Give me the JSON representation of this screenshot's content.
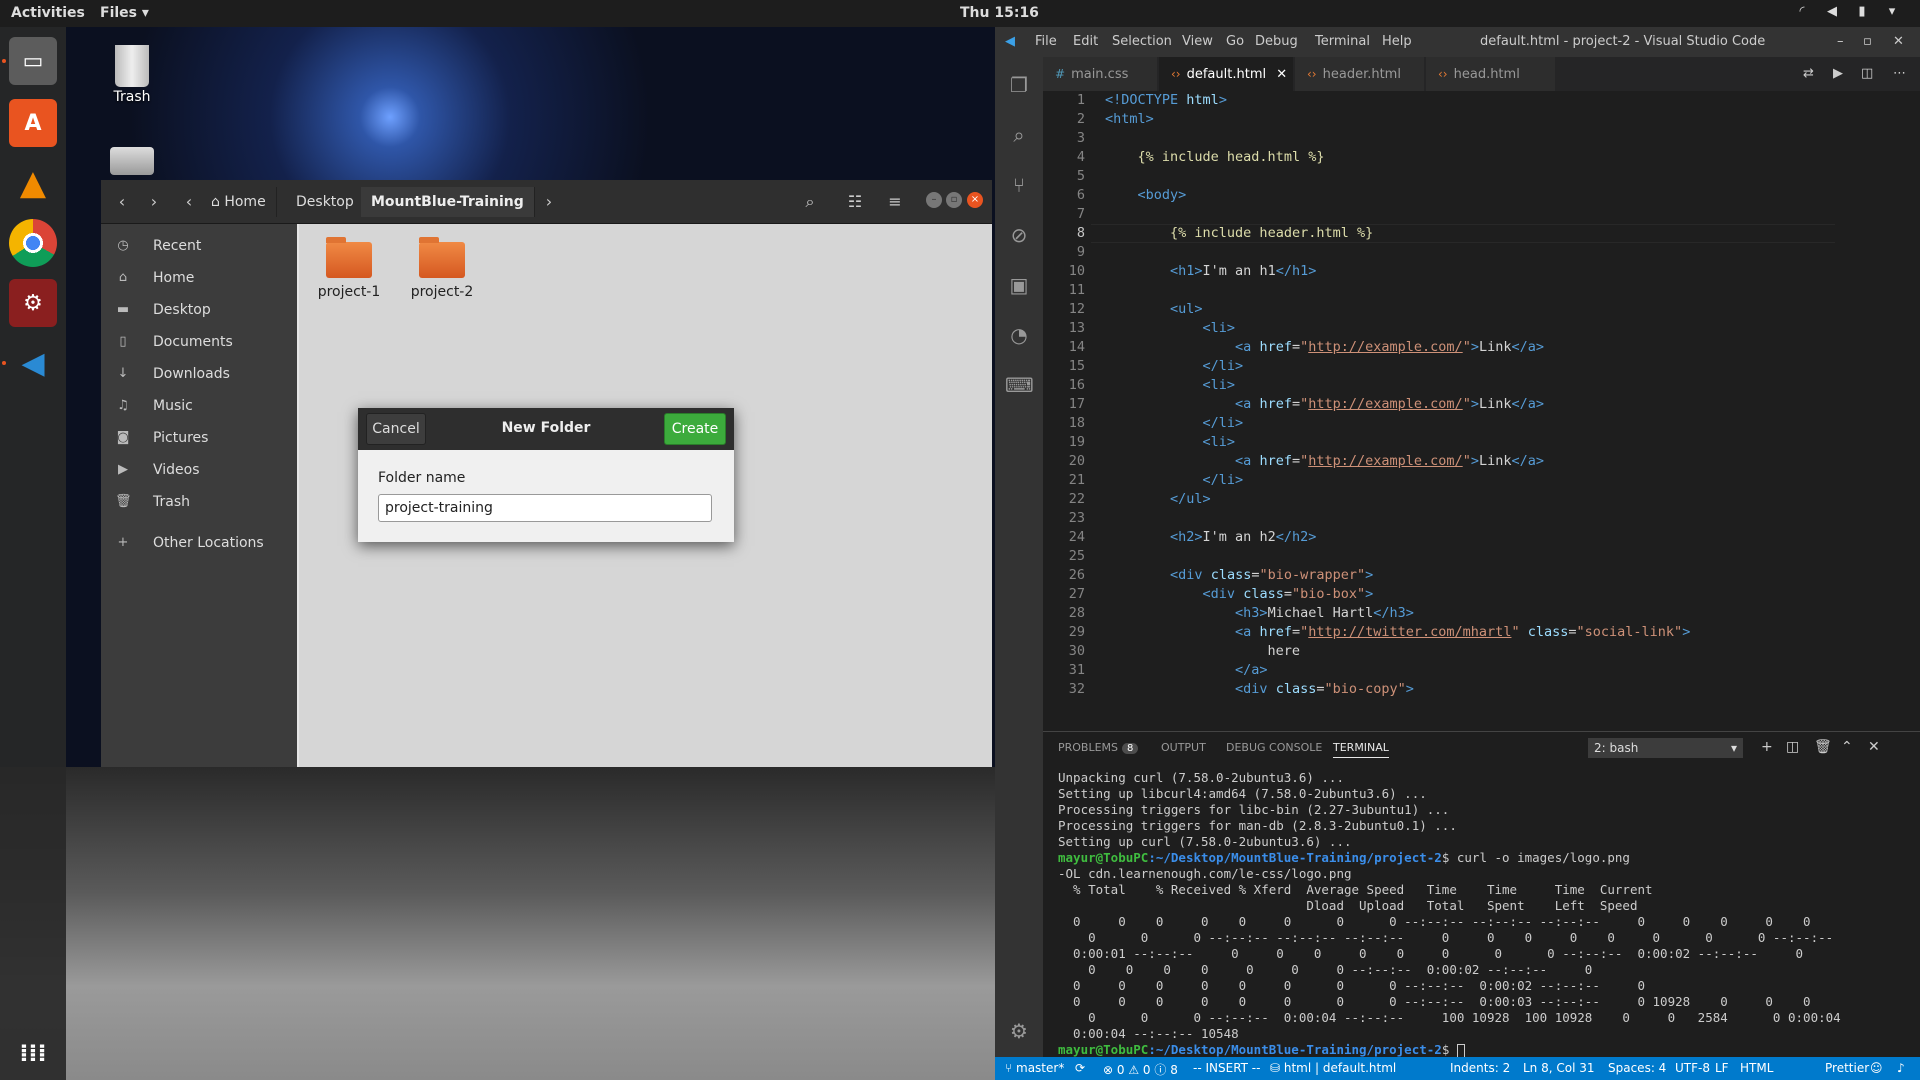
{
  "topbar": {
    "activities": "Activities",
    "app_menu": "Files ▾",
    "clock": "Thu 15:16"
  },
  "desktop": {
    "trash_label": "Trash"
  },
  "dock": {
    "items": [
      "files-app",
      "software-center",
      "vlc",
      "chrome",
      "system-tools",
      "vscode"
    ],
    "apps_grid": "show-apps"
  },
  "files": {
    "path": [
      "Home",
      "Desktop",
      "MountBlue-Training"
    ],
    "sidebar": [
      "Recent",
      "Home",
      "Desktop",
      "Documents",
      "Downloads",
      "Music",
      "Pictures",
      "Videos",
      "Trash",
      "Other Locations"
    ],
    "folders": [
      "project-1",
      "project-2"
    ]
  },
  "dialog": {
    "cancel": "Cancel",
    "title": "New Folder",
    "create": "Create",
    "field_label": "Folder name",
    "field_value": "project-training"
  },
  "vscode": {
    "menu": [
      "File",
      "Edit",
      "Selection",
      "View",
      "Go",
      "Debug",
      "Terminal",
      "Help"
    ],
    "window_title": "default.html - project-2 - Visual Studio Code",
    "tabs": [
      "main.css",
      "default.html",
      "header.html",
      "head.html"
    ],
    "active_tab": "default.html",
    "line_numbers": [
      "1",
      "2",
      "3",
      "4",
      "5",
      "6",
      "7",
      "8",
      "9",
      "10",
      "11",
      "12",
      "13",
      "14",
      "15",
      "16",
      "17",
      "18",
      "19",
      "20",
      "21",
      "22",
      "23",
      "24",
      "25",
      "26",
      "27",
      "28",
      "29",
      "30",
      "31",
      "32"
    ],
    "current_line": "8",
    "panel_tabs": {
      "problems": "PROBLEMS",
      "problems_count": "8",
      "output": "OUTPUT",
      "debug": "DEBUG CONSOLE",
      "terminal": "TERMINAL"
    },
    "terminal_select": "2: bash",
    "terminal_lines": [
      "Unpacking curl (7.58.0-2ubuntu3.6) ...",
      "Setting up libcurl4:amd64 (7.58.0-2ubuntu3.6) ...",
      "Processing triggers for libc-bin (2.27-3ubuntu1) ...",
      "Processing triggers for man-db (2.8.3-2ubuntu0.1) ...",
      "Setting up curl (7.58.0-2ubuntu3.6) ..."
    ],
    "prompt_user": "mayur@TobuPC",
    "prompt_path": ":~/Desktop/MountBlue-Training/project-2",
    "command": "$ curl -o images/logo.png",
    "command_cont": "-OL cdn.learnenough.com/le-css/logo.png",
    "curl_header_1": "  % Total    % Received % Xferd  Average Speed   Time    Time     Time  Current",
    "curl_header_2": "                                 Dload  Upload   Total   Spent    Left  Speed",
    "curl_rows": [
      "  0     0    0     0    0     0      0      0 --:--:-- --:--:-- --:--:--     0     0    0     0    0",
      "    0      0      0 --:--:-- --:--:-- --:--:--     0     0    0     0    0     0      0      0 --:--:--",
      "  0:00:01 --:--:--     0     0    0     0    0     0      0      0 --:--:--  0:00:02 --:--:--     0",
      "    0    0    0    0     0     0     0 --:--:--  0:00:02 --:--:--     0",
      "  0     0    0     0    0     0      0      0 --:--:--  0:00:02 --:--:--     0",
      "  0     0    0     0    0     0      0      0 --:--:--  0:00:03 --:--:--     0 10928    0     0    0",
      "    0      0      0 --:--:--  0:00:04 --:--:--     100 10928  100 10928    0     0   2584      0 0:00:04",
      "  0:00:04 --:--:-- 10548"
    ],
    "prompt_end": "$ ",
    "status": {
      "branch": "master*",
      "errors": "0",
      "warnings": "0",
      "info": "8",
      "mode": "-- INSERT --",
      "lang_crumb": "html | default.html",
      "indents": "Indents: 2",
      "position": "Ln 8, Col 31",
      "spaces": "Spaces: 4",
      "encoding": "UTF-8",
      "eol": "LF",
      "language": "HTML",
      "prettier": "Prettier"
    }
  },
  "colors": {
    "accent": "#007acc",
    "create": "#3cab3c",
    "folder": "#e06a2a"
  }
}
